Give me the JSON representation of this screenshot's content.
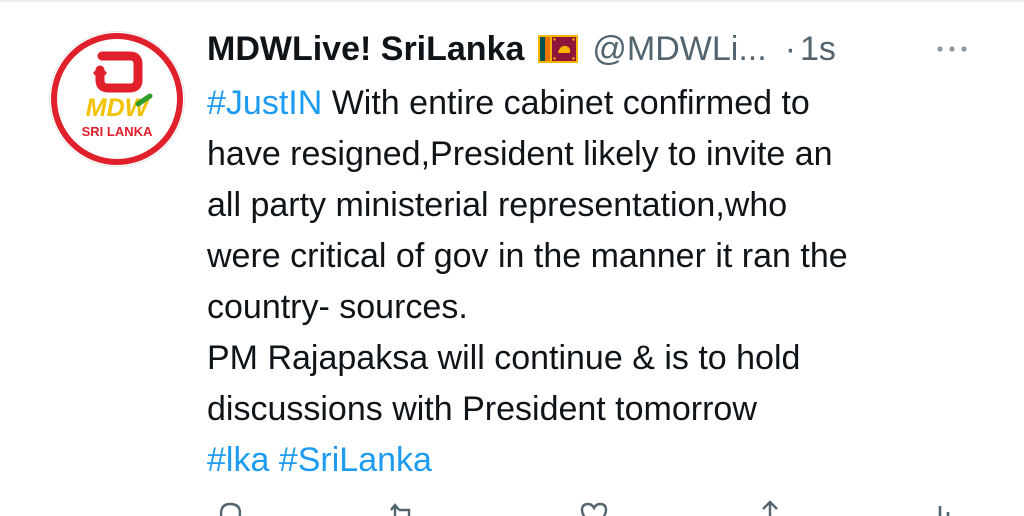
{
  "tweet": {
    "author": {
      "display_name": "MDWLive! SriLanka",
      "handle": "@MDWLi...",
      "avatar_text": "SRI LANKA",
      "avatar_mark": "MDW"
    },
    "separator": "·",
    "time": "1s",
    "lines": [
      {
        "hashtag": "#JustIN",
        "text": " With entire cabinet confirmed to"
      },
      {
        "text": "have resigned,President likely to invite an"
      },
      {
        "text": "all party ministerial representation,who"
      },
      {
        "text": "were critical of gov in the manner it ran the"
      },
      {
        "text": "country- sources."
      },
      {
        "text": "PM Rajapaksa will continue & is to hold"
      },
      {
        "text": "discussions with President tomorrow"
      }
    ],
    "hashtags_line": [
      "#lka",
      "#SriLanka"
    ]
  },
  "icons": {
    "flag": "sri-lanka-flag-icon",
    "more": "more-options-icon",
    "reply": "reply-icon",
    "retweet": "retweet-icon",
    "like": "like-icon",
    "share": "share-icon",
    "analytics": "analytics-icon"
  },
  "colors": {
    "hashtag": "#1d9bf0",
    "muted": "#536471",
    "text": "#0f1419",
    "avatar_ring": "#e0202a",
    "avatar_green": "#2e9e2e",
    "avatar_yellow": "#f2c200"
  }
}
